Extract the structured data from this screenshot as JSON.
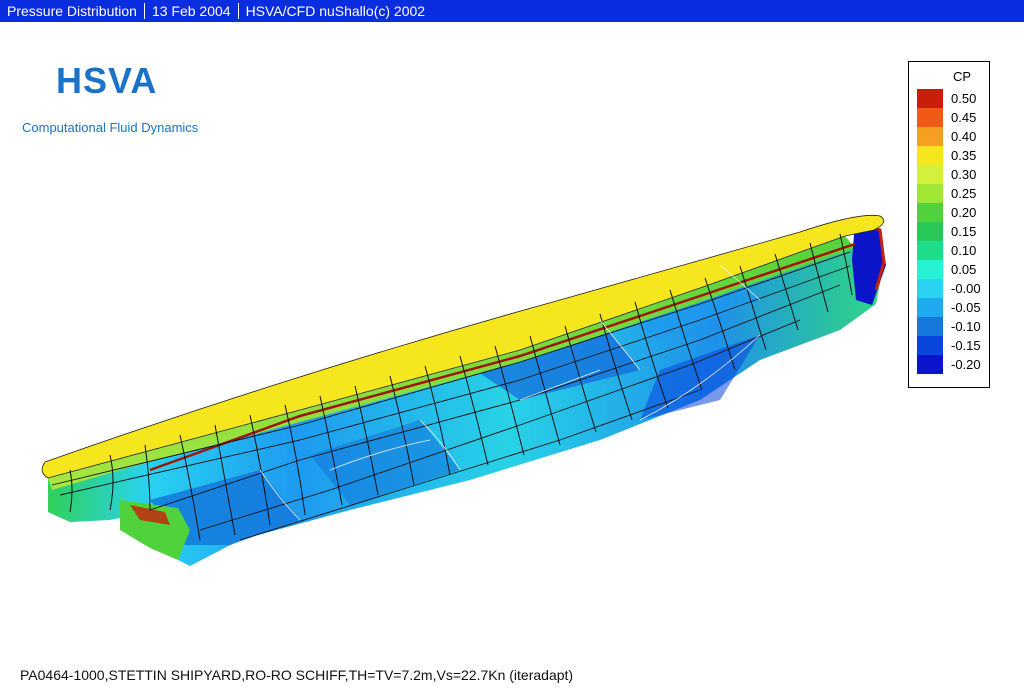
{
  "title_bar": {
    "segments": [
      "Pressure Distribution",
      "13 Feb 2004",
      "HSVA/CFD nuShallo(c) 2002"
    ]
  },
  "branding": {
    "logo": "HSVA",
    "subtitle": "Computational Fluid Dynamics",
    "color": "#1a73c8"
  },
  "legend": {
    "title": "CP",
    "entries": [
      {
        "label": "0.50",
        "color": "#c81e0a"
      },
      {
        "label": "0.45",
        "color": "#f05a14"
      },
      {
        "label": "0.40",
        "color": "#f5a020"
      },
      {
        "label": "0.35",
        "color": "#f5e61e"
      },
      {
        "label": "0.30",
        "color": "#d2f03c"
      },
      {
        "label": "0.25",
        "color": "#a0e632"
      },
      {
        "label": "0.20",
        "color": "#50d23c"
      },
      {
        "label": "0.15",
        "color": "#28c85a"
      },
      {
        "label": "0.10",
        "color": "#1edc8c"
      },
      {
        "label": "0.05",
        "color": "#28f0d2"
      },
      {
        "label": "-0.00",
        "color": "#28d2f0"
      },
      {
        "label": "-0.05",
        "color": "#1eaaf0"
      },
      {
        "label": "-0.10",
        "color": "#1478dc"
      },
      {
        "label": "-0.15",
        "color": "#0a46dc"
      },
      {
        "label": "-0.20",
        "color": "#0a14c8"
      }
    ]
  },
  "caption": "PA0464-1000,STETTIN SHIPYARD,RO-RO SCHIFF,TH=TV=7.2m,Vs=22.7Kn (iteradapt)"
}
